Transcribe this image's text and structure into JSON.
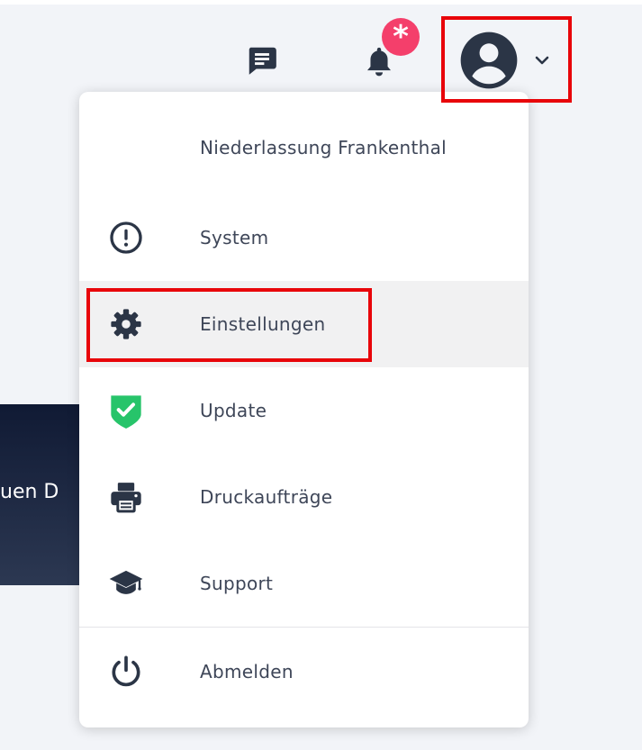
{
  "header": {
    "notification_badge": "*"
  },
  "banner": {
    "text": "uen D"
  },
  "menu": {
    "branch_label": "Niederlassung  Frankenthal",
    "items": [
      {
        "label": "System",
        "icon": "alert-circle-icon"
      },
      {
        "label": "Einstellungen",
        "icon": "gear-icon",
        "active": true
      },
      {
        "label": "Update",
        "icon": "shield-check-icon"
      },
      {
        "label": "Druckaufträge",
        "icon": "printer-icon"
      },
      {
        "label": "Support",
        "icon": "graduation-cap-icon"
      }
    ],
    "logout": {
      "label": "Abmelden",
      "icon": "power-icon"
    }
  },
  "colors": {
    "icon": "#2b3546",
    "badge": "#f43f6b",
    "shield": "#27c46a",
    "highlight": "#e8050a",
    "active_row": "#f1f1f2"
  }
}
